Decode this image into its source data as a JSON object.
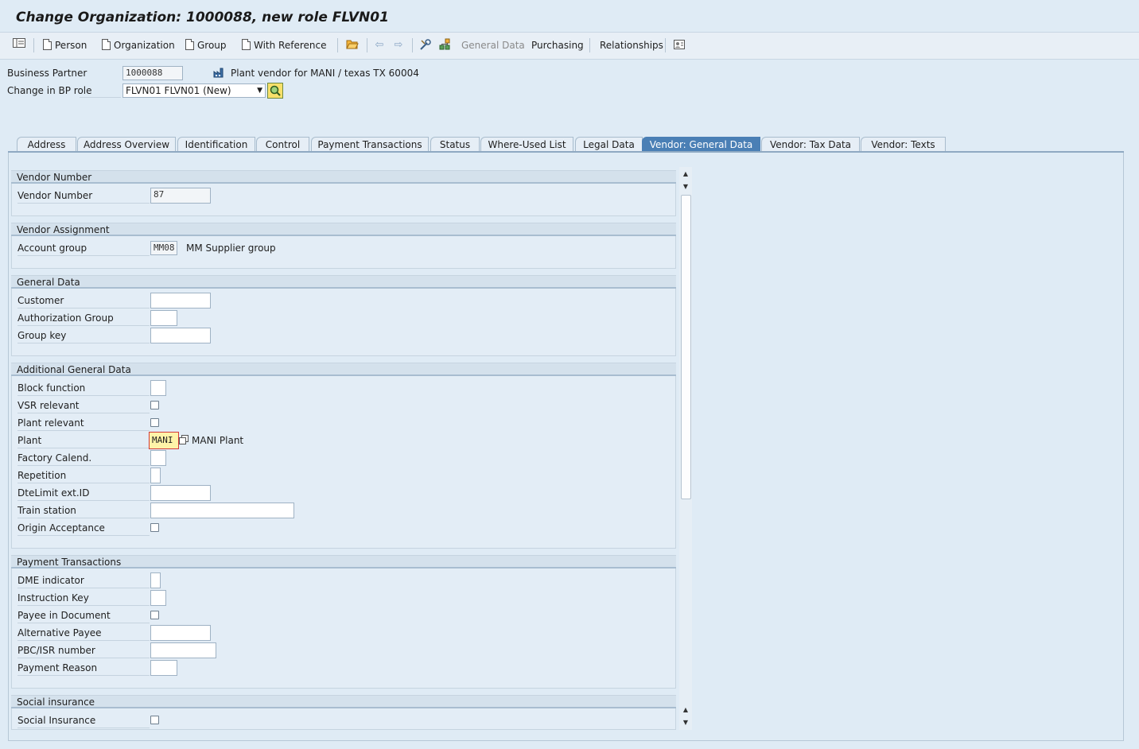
{
  "window": {
    "title": "Change Organization: 1000088, new role FLVN01"
  },
  "toolbar": {
    "person_label": "Person",
    "organization_label": "Organization",
    "group_label": "Group",
    "with_reference_label": "With Reference",
    "general_data_label": "General Data",
    "purchasing_label": "Purchasing",
    "relationships_label": "Relationships"
  },
  "header": {
    "business_partner_label": "Business Partner",
    "business_partner_value": "1000088",
    "business_partner_desc": "Plant vendor for MANI / texas TX 60004",
    "change_role_label": "Change in BP role",
    "change_role_value": "FLVN01 FLVN01 (New)"
  },
  "tabs": [
    {
      "label": "Address"
    },
    {
      "label": "Address Overview"
    },
    {
      "label": "Identification"
    },
    {
      "label": "Control"
    },
    {
      "label": "Payment Transactions"
    },
    {
      "label": "Status"
    },
    {
      "label": "Where-Used List"
    },
    {
      "label": "Legal Data"
    },
    {
      "label": "Vendor: General Data",
      "active": true
    },
    {
      "label": "Vendor: Tax Data"
    },
    {
      "label": "Vendor: Texts"
    }
  ],
  "groups": {
    "vendor_number": {
      "title": "Vendor Number",
      "vendor_number_label": "Vendor Number",
      "vendor_number_value": "87"
    },
    "vendor_assignment": {
      "title": "Vendor Assignment",
      "account_group_label": "Account group",
      "account_group_value": "MM08",
      "account_group_desc": "MM Supplier group"
    },
    "general_data": {
      "title": "General Data",
      "customer_label": "Customer",
      "customer_value": "",
      "authorization_group_label": "Authorization Group",
      "authorization_group_value": "",
      "group_key_label": "Group key",
      "group_key_value": ""
    },
    "additional_general_data": {
      "title": "Additional General Data",
      "block_function_label": "Block function",
      "vsr_relevant_label": "VSR relevant",
      "plant_relevant_label": "Plant relevant",
      "plant_label": "Plant",
      "plant_value": "MANI",
      "plant_desc": "MANI Plant",
      "factory_calendar_label": "Factory Calend.",
      "repetition_label": "Repetition",
      "dtelimit_label": "DteLimit ext.ID",
      "train_station_label": "Train station",
      "origin_acceptance_label": "Origin Acceptance"
    },
    "payment_transactions": {
      "title": "Payment Transactions",
      "dme_indicator_label": "DME indicator",
      "instruction_key_label": "Instruction Key",
      "payee_in_document_label": "Payee in Document",
      "alternative_payee_label": "Alternative Payee",
      "pbc_isr_label": "PBC/ISR number",
      "payment_reason_label": "Payment Reason"
    },
    "social_insurance": {
      "title": "Social insurance",
      "social_insurance_label": "Social Insurance"
    }
  },
  "colors": {
    "active_tab": "#4a7fb5",
    "background": "#dfebf5",
    "highlight_field": "#fff3a8"
  }
}
